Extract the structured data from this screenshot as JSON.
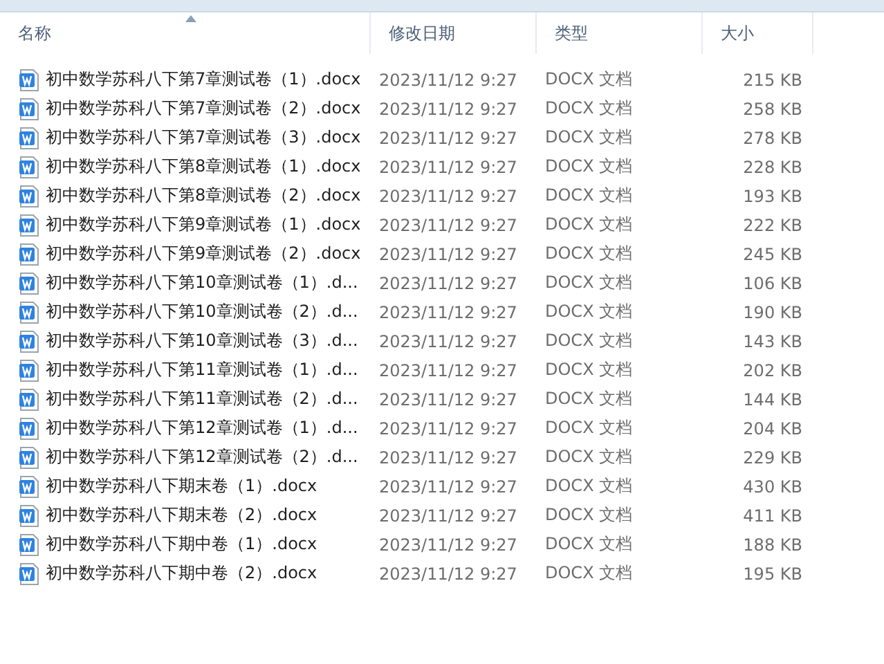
{
  "columns": [
    {
      "label": "名称",
      "sorted": true
    },
    {
      "label": "修改日期",
      "sorted": false
    },
    {
      "label": "类型",
      "sorted": false
    },
    {
      "label": "大小",
      "sorted": false
    }
  ],
  "files": [
    {
      "name": "初中数学苏科八下第7章测试卷（1）.docx",
      "date": "2023/11/12 9:27",
      "type": "DOCX 文档",
      "size": "215 KB"
    },
    {
      "name": "初中数学苏科八下第7章测试卷（2）.docx",
      "date": "2023/11/12 9:27",
      "type": "DOCX 文档",
      "size": "258 KB"
    },
    {
      "name": "初中数学苏科八下第7章测试卷（3）.docx",
      "date": "2023/11/12 9:27",
      "type": "DOCX 文档",
      "size": "278 KB"
    },
    {
      "name": "初中数学苏科八下第8章测试卷（1）.docx",
      "date": "2023/11/12 9:27",
      "type": "DOCX 文档",
      "size": "228 KB"
    },
    {
      "name": "初中数学苏科八下第8章测试卷（2）.docx",
      "date": "2023/11/12 9:27",
      "type": "DOCX 文档",
      "size": "193 KB"
    },
    {
      "name": "初中数学苏科八下第9章测试卷（1）.docx",
      "date": "2023/11/12 9:27",
      "type": "DOCX 文档",
      "size": "222 KB"
    },
    {
      "name": "初中数学苏科八下第9章测试卷（2）.docx",
      "date": "2023/11/12 9:27",
      "type": "DOCX 文档",
      "size": "245 KB"
    },
    {
      "name": "初中数学苏科八下第10章测试卷（1）.d...",
      "date": "2023/11/12 9:27",
      "type": "DOCX 文档",
      "size": "106 KB"
    },
    {
      "name": "初中数学苏科八下第10章测试卷（2）.d...",
      "date": "2023/11/12 9:27",
      "type": "DOCX 文档",
      "size": "190 KB"
    },
    {
      "name": "初中数学苏科八下第10章测试卷（3）.d...",
      "date": "2023/11/12 9:27",
      "type": "DOCX 文档",
      "size": "143 KB"
    },
    {
      "name": "初中数学苏科八下第11章测试卷（1）.d...",
      "date": "2023/11/12 9:27",
      "type": "DOCX 文档",
      "size": "202 KB"
    },
    {
      "name": "初中数学苏科八下第11章测试卷（2）.d...",
      "date": "2023/11/12 9:27",
      "type": "DOCX 文档",
      "size": "144 KB"
    },
    {
      "name": "初中数学苏科八下第12章测试卷（1）.d...",
      "date": "2023/11/12 9:27",
      "type": "DOCX 文档",
      "size": "204 KB"
    },
    {
      "name": "初中数学苏科八下第12章测试卷（2）.d...",
      "date": "2023/11/12 9:27",
      "type": "DOCX 文档",
      "size": "229 KB"
    },
    {
      "name": "初中数学苏科八下期末卷（1）.docx",
      "date": "2023/11/12 9:27",
      "type": "DOCX 文档",
      "size": "430 KB"
    },
    {
      "name": "初中数学苏科八下期末卷（2）.docx",
      "date": "2023/11/12 9:27",
      "type": "DOCX 文档",
      "size": "411 KB"
    },
    {
      "name": "初中数学苏科八下期中卷（1）.docx",
      "date": "2023/11/12 9:27",
      "type": "DOCX 文档",
      "size": "188 KB"
    },
    {
      "name": "初中数学苏科八下期中卷（2）.docx",
      "date": "2023/11/12 9:27",
      "type": "DOCX 文档",
      "size": "195 KB"
    }
  ]
}
